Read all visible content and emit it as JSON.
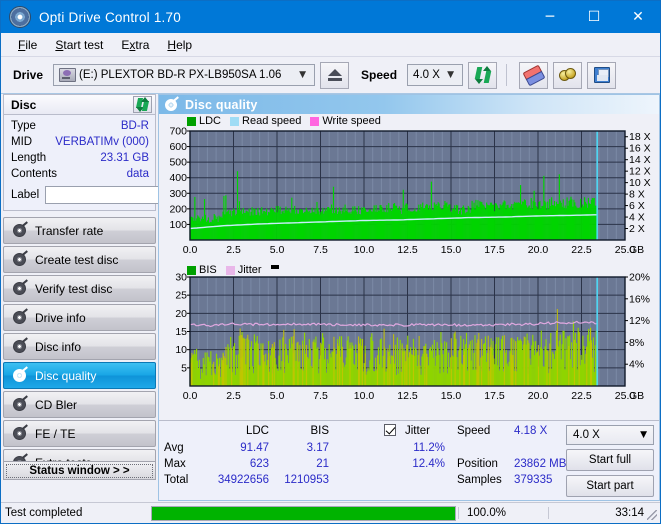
{
  "window": {
    "title": "Opti Drive Control 1.70",
    "icon": "disc-icon",
    "minimize": "─",
    "maximize": "☐",
    "close": "✕"
  },
  "menu": [
    {
      "label": "File",
      "accel": "F"
    },
    {
      "label": "Start test",
      "accel": "S"
    },
    {
      "label": "Extra",
      "accel": "x"
    },
    {
      "label": "Help",
      "accel": "H"
    }
  ],
  "toolbar": {
    "drive_label": "Drive",
    "drive_value": "(E:)   PLEXTOR BD-R  PX-LB950SA 1.06",
    "eject_title": "Eject",
    "speed_label": "Speed",
    "speed_value": "4.0 X",
    "refresh_title": "Refresh",
    "eraser_title": "Erase",
    "coin_title": "Scan",
    "save_title": "Save"
  },
  "sidebar": {
    "disc_panel": {
      "title": "Disc",
      "refresh_title": "Refresh disc info",
      "rows": [
        {
          "key": "Type",
          "value": "BD-R"
        },
        {
          "key": "MID",
          "value": "VERBATIMv (000)"
        },
        {
          "key": "Length",
          "value": "23.31 GB"
        },
        {
          "key": "Contents",
          "value": "data"
        }
      ],
      "label_key": "Label",
      "label_value": "",
      "label_placeholder": "",
      "cd_button_title": "Disc label"
    },
    "nav": [
      {
        "label": "Transfer rate",
        "active": false
      },
      {
        "label": "Create test disc",
        "active": false
      },
      {
        "label": "Verify test disc",
        "active": false
      },
      {
        "label": "Drive info",
        "active": false
      },
      {
        "label": "Disc info",
        "active": false
      },
      {
        "label": "Disc quality",
        "active": true
      },
      {
        "label": "CD Bler",
        "active": false
      },
      {
        "label": "FE / TE",
        "active": false
      },
      {
        "label": "Extra tests",
        "active": false
      }
    ],
    "status_window_button": "Status window > >"
  },
  "content": {
    "header_title": "Disc quality",
    "header_icon": "disc-quality-icon"
  },
  "stats": {
    "col_ldc": "LDC",
    "col_bis": "BIS",
    "jitter_label": "Jitter",
    "jitter_checked": true,
    "rows": [
      {
        "name": "Avg",
        "ldc": "91.47",
        "bis": "3.17",
        "jitter": "11.2%"
      },
      {
        "name": "Max",
        "ldc": "623",
        "bis": "21",
        "jitter": "12.4%"
      },
      {
        "name": "Total",
        "ldc": "34922656",
        "bis": "1210953",
        "jitter": ""
      }
    ],
    "speed_key": "Speed",
    "speed_value": "4.18 X",
    "position_key": "Position",
    "position_value": "23862 MB",
    "samples_key": "Samples",
    "samples_value": "379335",
    "speed_select": "4.0 X",
    "start_full": "Start full",
    "start_part": "Start part"
  },
  "statusbar": {
    "text": "Test completed",
    "percent_label": "100.0%",
    "percent_value": 100,
    "time": "33:14"
  },
  "colors": {
    "accent": "#0078d7",
    "ldc_green": "#00d400",
    "bis_green": "#7fd400",
    "jitter_pink": "#e9b7e9",
    "read_speed": "#9fdcf5",
    "write_speed": "#ff66e0",
    "plot_bg": "#6b7894",
    "value_blue": "#2b2bc8",
    "progress_green": "#00b300"
  },
  "chart_data": [
    {
      "type": "area",
      "title": "LDC / Read speed",
      "legend": [
        {
          "label": "LDC",
          "color": "#00a000"
        },
        {
          "label": "Read speed",
          "color": "#9fdcf5"
        },
        {
          "label": "Write speed",
          "color": "#ff66e0"
        }
      ],
      "legend_position": "top-left",
      "xlabel": "GB",
      "xlim": [
        0,
        25
      ],
      "xticks": [
        "0.0",
        "2.5",
        "5.0",
        "7.5",
        "10.0",
        "12.5",
        "15.0",
        "17.5",
        "20.0",
        "22.5",
        "25.0"
      ],
      "ylabel_left": "LDC",
      "ylim": [
        0,
        700
      ],
      "yticks": [
        100,
        200,
        300,
        400,
        500,
        600,
        700
      ],
      "ylabel_right": "Speed",
      "ylim_right": [
        0,
        19
      ],
      "yticks_right": [
        "2 X",
        "4 X",
        "6 X",
        "8 X",
        "10 X",
        "12 X",
        "14 X",
        "16 X",
        "18 X"
      ],
      "grid": true,
      "data_end_gb": 23.4,
      "series": [
        {
          "name": "LDC",
          "color": "#00d400",
          "x": [
            0.0,
            0.2,
            0.4,
            0.6,
            0.8,
            1.0,
            1.2,
            1.4,
            1.6,
            1.8,
            2.0,
            2.2,
            2.4,
            2.6,
            2.8,
            3.0,
            3.2,
            3.4,
            3.6,
            3.8,
            4.0,
            4.2,
            4.4,
            4.6,
            4.8,
            5.0,
            5.2,
            5.4,
            5.6,
            5.8,
            6.0,
            6.2,
            6.4,
            6.6,
            6.8,
            7.0,
            7.2,
            7.4,
            7.6,
            7.8,
            8.0,
            8.2,
            8.4,
            8.6,
            8.8,
            9.0,
            9.2,
            9.4,
            9.6,
            9.8,
            10.0,
            10.2,
            10.4,
            10.6,
            10.8,
            11.0,
            11.2,
            11.4,
            11.6,
            11.8,
            12.0,
            12.2,
            12.4,
            12.6,
            12.8,
            13.0,
            13.2,
            13.4,
            13.6,
            13.8,
            14.0,
            14.2,
            14.4,
            14.6,
            14.8,
            15.0,
            15.2,
            15.4,
            15.6,
            15.8,
            16.0,
            16.2,
            16.4,
            16.6,
            16.8,
            17.0,
            17.2,
            17.4,
            17.6,
            17.8,
            18.0,
            18.2,
            18.4,
            18.6,
            18.8,
            19.0,
            19.2,
            19.4,
            19.6,
            19.8,
            20.0,
            20.2,
            20.4,
            20.6,
            20.8,
            21.0,
            21.2,
            21.4,
            21.6,
            21.8,
            22.0,
            22.2,
            22.4,
            22.6,
            22.8,
            23.0,
            23.2,
            23.4
          ],
          "y": [
            150,
            140,
            160,
            135,
            150,
            145,
            130,
            155,
            140,
            150,
            205,
            200,
            210,
            200,
            425,
            205,
            200,
            210,
            200,
            205,
            200,
            210,
            205,
            410,
            205,
            200,
            210,
            200,
            205,
            200,
            215,
            205,
            200,
            210,
            205,
            200,
            215,
            205,
            200,
            210,
            200,
            215,
            205,
            200,
            210,
            205,
            200,
            215,
            205,
            200,
            210,
            300,
            205,
            330,
            210,
            320,
            205,
            215,
            310,
            205,
            215,
            205,
            355,
            200,
            215,
            205,
            300,
            210,
            330,
            205,
            215,
            370,
            205,
            210,
            380,
            200,
            215,
            205,
            200,
            210,
            220,
            215,
            620,
            240,
            230,
            225,
            215,
            230,
            225,
            220,
            395,
            230,
            415,
            235,
            230,
            225,
            245,
            230,
            460,
            240,
            235,
            250,
            240,
            245,
            255,
            250,
            385,
            255,
            250,
            430,
            260,
            265,
            270,
            290,
            300,
            490,
            300,
            290
          ]
        },
        {
          "name": "Read speed",
          "color": "#b6e9fa",
          "x": [
            0.0,
            2.0,
            4.0,
            6.0,
            8.0,
            10.0,
            12.0,
            14.0,
            16.0,
            18.0,
            20.0,
            22.0,
            23.4
          ],
          "y_speed": [
            2.0,
            2.5,
            2.8,
            3.0,
            3.2,
            3.4,
            3.5,
            3.7,
            3.9,
            4.0,
            4.2,
            4.3,
            4.4
          ]
        }
      ],
      "cursor_gb": 23.4
    },
    {
      "type": "area",
      "title": "BIS / Jitter",
      "legend": [
        {
          "label": "BIS",
          "color": "#00a000"
        },
        {
          "label": "Jitter",
          "color": "#e9b7e9"
        }
      ],
      "legend_position": "top-left",
      "xlabel": "GB",
      "xlim": [
        0,
        25
      ],
      "xticks": [
        "0.0",
        "2.5",
        "5.0",
        "7.5",
        "10.0",
        "12.5",
        "15.0",
        "17.5",
        "20.0",
        "22.5",
        "25.0"
      ],
      "ylabel_left": "BIS",
      "ylim": [
        0,
        30
      ],
      "yticks": [
        5,
        10,
        15,
        20,
        25,
        30
      ],
      "ylabel_right": "Jitter",
      "ylim_right": [
        0,
        20
      ],
      "yticks_right": [
        "4%",
        "8%",
        "12%",
        "16%",
        "20%"
      ],
      "grid": true,
      "data_end_gb": 23.4,
      "series": [
        {
          "name": "BIS",
          "color": "#8fd400",
          "x": [
            0.0,
            0.3,
            0.6,
            0.9,
            1.2,
            1.5,
            1.8,
            2.1,
            2.4,
            2.7,
            3.0,
            3.3,
            3.6,
            3.9,
            4.2,
            4.5,
            4.8,
            5.1,
            5.4,
            5.7,
            6.0,
            6.3,
            6.6,
            6.9,
            7.2,
            7.5,
            7.8,
            8.1,
            8.4,
            8.7,
            9.0,
            9.3,
            9.6,
            9.9,
            10.2,
            10.5,
            10.8,
            11.1,
            11.4,
            11.7,
            12.0,
            12.3,
            12.6,
            12.9,
            13.2,
            13.5,
            13.8,
            14.1,
            14.4,
            14.7,
            15.0,
            15.3,
            15.6,
            15.9,
            16.2,
            16.5,
            16.8,
            17.1,
            17.4,
            17.7,
            18.0,
            18.3,
            18.6,
            18.9,
            19.2,
            19.5,
            19.8,
            20.1,
            20.4,
            20.7,
            21.0,
            21.3,
            21.6,
            21.9,
            22.2,
            22.5,
            22.8,
            23.1,
            23.4
          ],
          "y": [
            9,
            10,
            8,
            9.5,
            10,
            9,
            8.5,
            12,
            14,
            13,
            16,
            14,
            13,
            14.5,
            13,
            14,
            15,
            13,
            14,
            13.5,
            14,
            13,
            14.5,
            13,
            14,
            13.5,
            14,
            13,
            14,
            13.5,
            14,
            13,
            14.5,
            13,
            14,
            15,
            13,
            14,
            13.5,
            14,
            13,
            14.5,
            13,
            14,
            13.5,
            13,
            14,
            13.5,
            14,
            13,
            13.5,
            13,
            14,
            13.5,
            13,
            14,
            13.5,
            14,
            13,
            13.5,
            14,
            13.5,
            14,
            15,
            14,
            13.5,
            14,
            15,
            14.5,
            15,
            21,
            15,
            16,
            15.5,
            17,
            16,
            17,
            16.5,
            15
          ]
        },
        {
          "name": "Jitter",
          "color": "#e0a8e0",
          "x": [
            0.0,
            0.5,
            1.0,
            1.5,
            2.0,
            2.5,
            3.0,
            3.5,
            4.0,
            4.5,
            5.0,
            5.5,
            6.0,
            6.5,
            7.0,
            7.5,
            8.0,
            8.5,
            9.0,
            9.5,
            10.0,
            10.5,
            11.0,
            11.5,
            12.0,
            12.5,
            13.0,
            13.5,
            14.0,
            14.5,
            15.0,
            15.5,
            16.0,
            16.5,
            17.0,
            17.5,
            18.0,
            18.5,
            19.0,
            19.5,
            20.0,
            20.5,
            21.0,
            21.5,
            22.0,
            22.5,
            23.0,
            23.4
          ],
          "y_pct": [
            11.2,
            11.2,
            11.1,
            11.2,
            11.3,
            11.4,
            11.4,
            11.3,
            11.3,
            11.3,
            11.3,
            11.3,
            11.3,
            11.4,
            11.4,
            11.3,
            11.2,
            11.3,
            11.3,
            11.2,
            11.2,
            11.2,
            11.2,
            11.2,
            11.2,
            11.2,
            11.2,
            11.2,
            11.2,
            11.2,
            11.2,
            11.2,
            11.2,
            11.2,
            11.2,
            11.2,
            11.2,
            11.3,
            11.3,
            11.3,
            11.4,
            11.5,
            11.6,
            11.5,
            11.6,
            11.7,
            11.6,
            11.5
          ]
        }
      ],
      "cursor_gb": 23.4
    }
  ]
}
